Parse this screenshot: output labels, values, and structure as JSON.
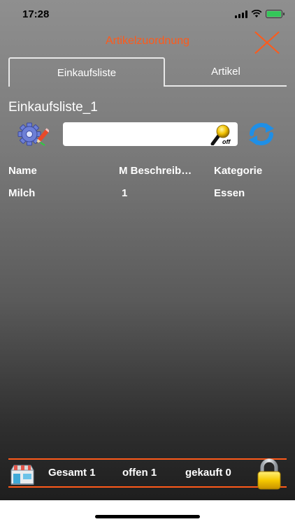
{
  "status_bar": {
    "time": "17:28"
  },
  "header": {
    "title": "Artikelzuordnung"
  },
  "tabs": [
    {
      "label": "Einkaufsliste",
      "active": true
    },
    {
      "label": "Artikel",
      "active": false
    }
  ],
  "list": {
    "title": "Einkaufsliste_1"
  },
  "search": {
    "value": "",
    "placeholder": "",
    "mic_state": "off"
  },
  "table": {
    "columns": [
      "Name",
      "M Beschreib…",
      "Kategorie"
    ],
    "rows": [
      {
        "name": "Milch",
        "menge": "1",
        "kategorie": "Essen"
      }
    ]
  },
  "footer": {
    "gesamt": "Gesamt 1",
    "offen": "offen 1",
    "gekauft": "gekauft 0"
  },
  "colors": {
    "accent": "#ff5a1a",
    "battery": "#34c759"
  },
  "icons": [
    "gear-edit-icon",
    "microphone-icon",
    "refresh-icon",
    "store-icon",
    "lock-icon",
    "close-icon"
  ]
}
